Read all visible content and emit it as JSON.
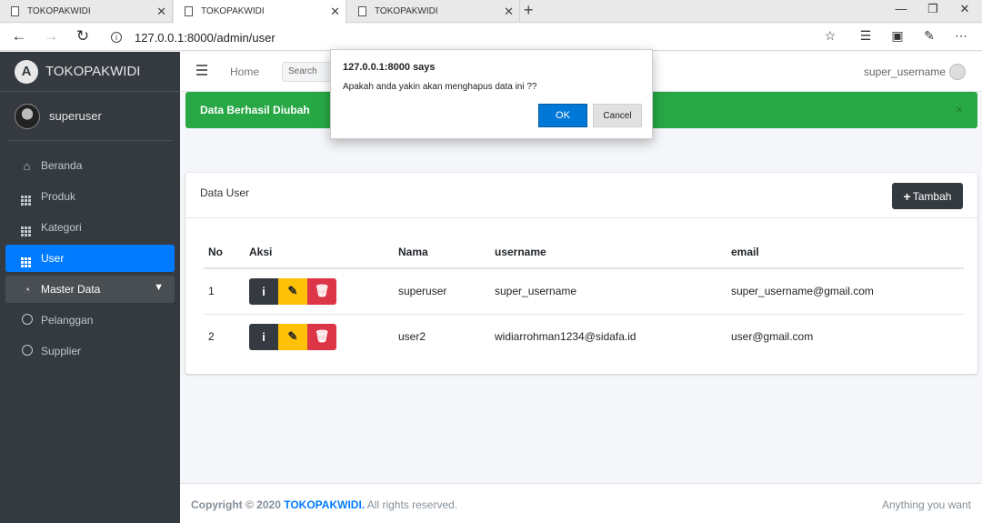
{
  "browser": {
    "tabs": [
      {
        "title": "TOKOPAKWIDI"
      },
      {
        "title": "TOKOPAKWIDI"
      },
      {
        "title": "TOKOPAKWIDI"
      }
    ],
    "url": "127.0.0.1:8000/admin/user"
  },
  "sidebar": {
    "brand": "TOKOPAKWIDI",
    "user": "superuser",
    "items": [
      {
        "label": "Beranda",
        "icon": "home-icon"
      },
      {
        "label": "Produk",
        "icon": "grid-icon"
      },
      {
        "label": "Kategori",
        "icon": "grid-icon"
      },
      {
        "label": "User",
        "icon": "grid-icon",
        "active": true
      },
      {
        "label": "Master Data",
        "icon": "dashboard-icon",
        "open": true
      },
      {
        "label": "Pelanggan",
        "icon": "circle-icon"
      },
      {
        "label": "Supplier",
        "icon": "circle-icon"
      }
    ]
  },
  "topnav": {
    "home": "Home",
    "search_placeholder": "Search",
    "user": "super_username"
  },
  "alert": {
    "message": "Data Berhasil Diubah",
    "close": "×"
  },
  "card": {
    "title": "Data User",
    "add_button": "Tambah",
    "columns": [
      "No",
      "Aksi",
      "Nama",
      "username",
      "email"
    ],
    "rows": [
      {
        "no": "1",
        "nama": "superuser",
        "username": "super_username",
        "email": "super_username@gmail.com"
      },
      {
        "no": "2",
        "nama": "user2",
        "username": "widiarrohman1234@sidafa.id",
        "email": "user@gmail.com"
      }
    ]
  },
  "footer": {
    "copyright_prefix": "Copyright © 2020",
    "brand": "TOKOPAKWIDI.",
    "rights": "All rights reserved.",
    "tagline": "Anything you want"
  },
  "dialog": {
    "title": "127.0.0.1:8000 says",
    "message": "Apakah anda yakin akan menghapus data ini ??",
    "ok": "OK",
    "cancel": "Cancel"
  },
  "colors": {
    "sidebar_bg": "#343a40",
    "active": "#007bff",
    "success": "#28a745",
    "warning": "#ffc107",
    "danger": "#dc3545"
  }
}
